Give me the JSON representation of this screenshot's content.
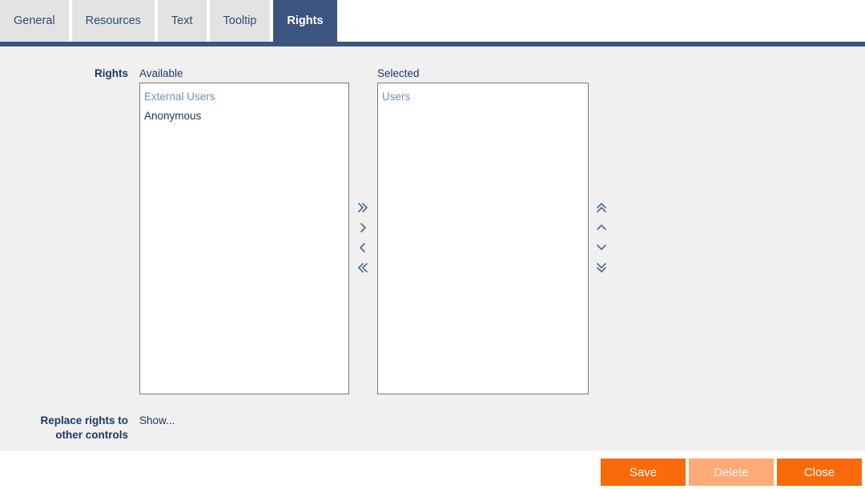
{
  "tabs": [
    {
      "label": "General",
      "active": false
    },
    {
      "label": "Resources",
      "active": false
    },
    {
      "label": "Text",
      "active": false
    },
    {
      "label": "Tooltip",
      "active": false
    },
    {
      "label": "Rights",
      "active": true
    }
  ],
  "form": {
    "rights_label": "Rights",
    "available_caption": "Available",
    "selected_caption": "Selected",
    "available_items": [
      {
        "label": "External Users",
        "style": "muted"
      },
      {
        "label": "Anonymous",
        "style": "normal"
      }
    ],
    "selected_items": [
      {
        "label": "Users",
        "style": "muted"
      }
    ],
    "replace_label_line1": "Replace rights to",
    "replace_label_line2": "other controls",
    "show_link": "Show..."
  },
  "transfer_arrows": [
    {
      "name": "move-all-right",
      "icon": "double-chevron-right"
    },
    {
      "name": "move-right",
      "icon": "chevron-right"
    },
    {
      "name": "move-left",
      "icon": "chevron-left"
    },
    {
      "name": "move-all-left",
      "icon": "double-chevron-left"
    }
  ],
  "order_arrows": [
    {
      "name": "move-to-top",
      "icon": "double-chevron-up"
    },
    {
      "name": "move-up",
      "icon": "chevron-up"
    },
    {
      "name": "move-down",
      "icon": "chevron-down"
    },
    {
      "name": "move-to-bottom",
      "icon": "double-chevron-down"
    }
  ],
  "footer": {
    "save_label": "Save",
    "delete_label": "Delete",
    "close_label": "Close"
  },
  "colors": {
    "accent_blue": "#3b5480",
    "text_blue": "#1f3864",
    "muted_blue": "#6d8fc4",
    "panel_gray": "#f0f0f0",
    "tab_gray": "#e3e3e3",
    "orange": "#f96a0b",
    "orange_disabled": "#ffab77"
  }
}
